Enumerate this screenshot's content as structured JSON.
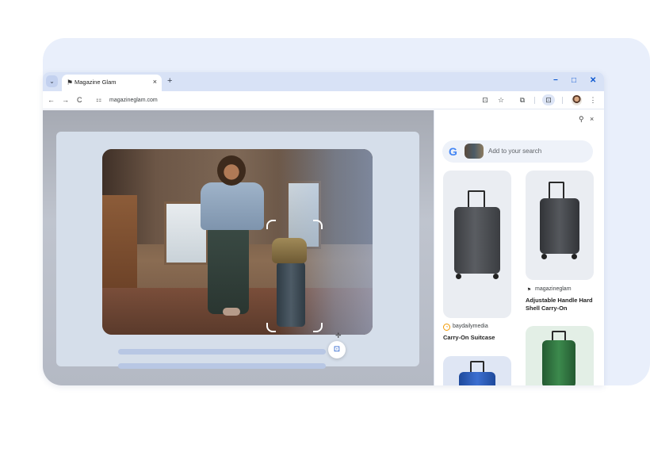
{
  "tab": {
    "title": "Magazine Glam",
    "close": "×",
    "menu": "⌄",
    "new_tab": "+"
  },
  "window_controls": {
    "minimize": "−",
    "maximize": "□",
    "close": "✕"
  },
  "toolbar": {
    "back": "←",
    "forward": "→",
    "reload": "C",
    "url": "magazineglam.com"
  },
  "side_panel": {
    "pin": "⚲",
    "close": "×",
    "search_placeholder": "Add to your search",
    "google_letter": "G",
    "results": [
      {
        "source": "baydailymedia",
        "title": "Carry-On Suitcase",
        "color": "#4a4c50"
      },
      {
        "source": "magazineglam",
        "title": "Adjustable Handle Hard Shell Carry-On",
        "color": "#3f4246"
      },
      {
        "source": "",
        "title": "",
        "color": "#2a55a8"
      },
      {
        "source": "",
        "title": "",
        "color": "#2f6b3c"
      }
    ]
  },
  "colors": {
    "accent": "#0b57d0",
    "backdrop": "#e9effb",
    "tabstrip": "#d8e2f6"
  }
}
